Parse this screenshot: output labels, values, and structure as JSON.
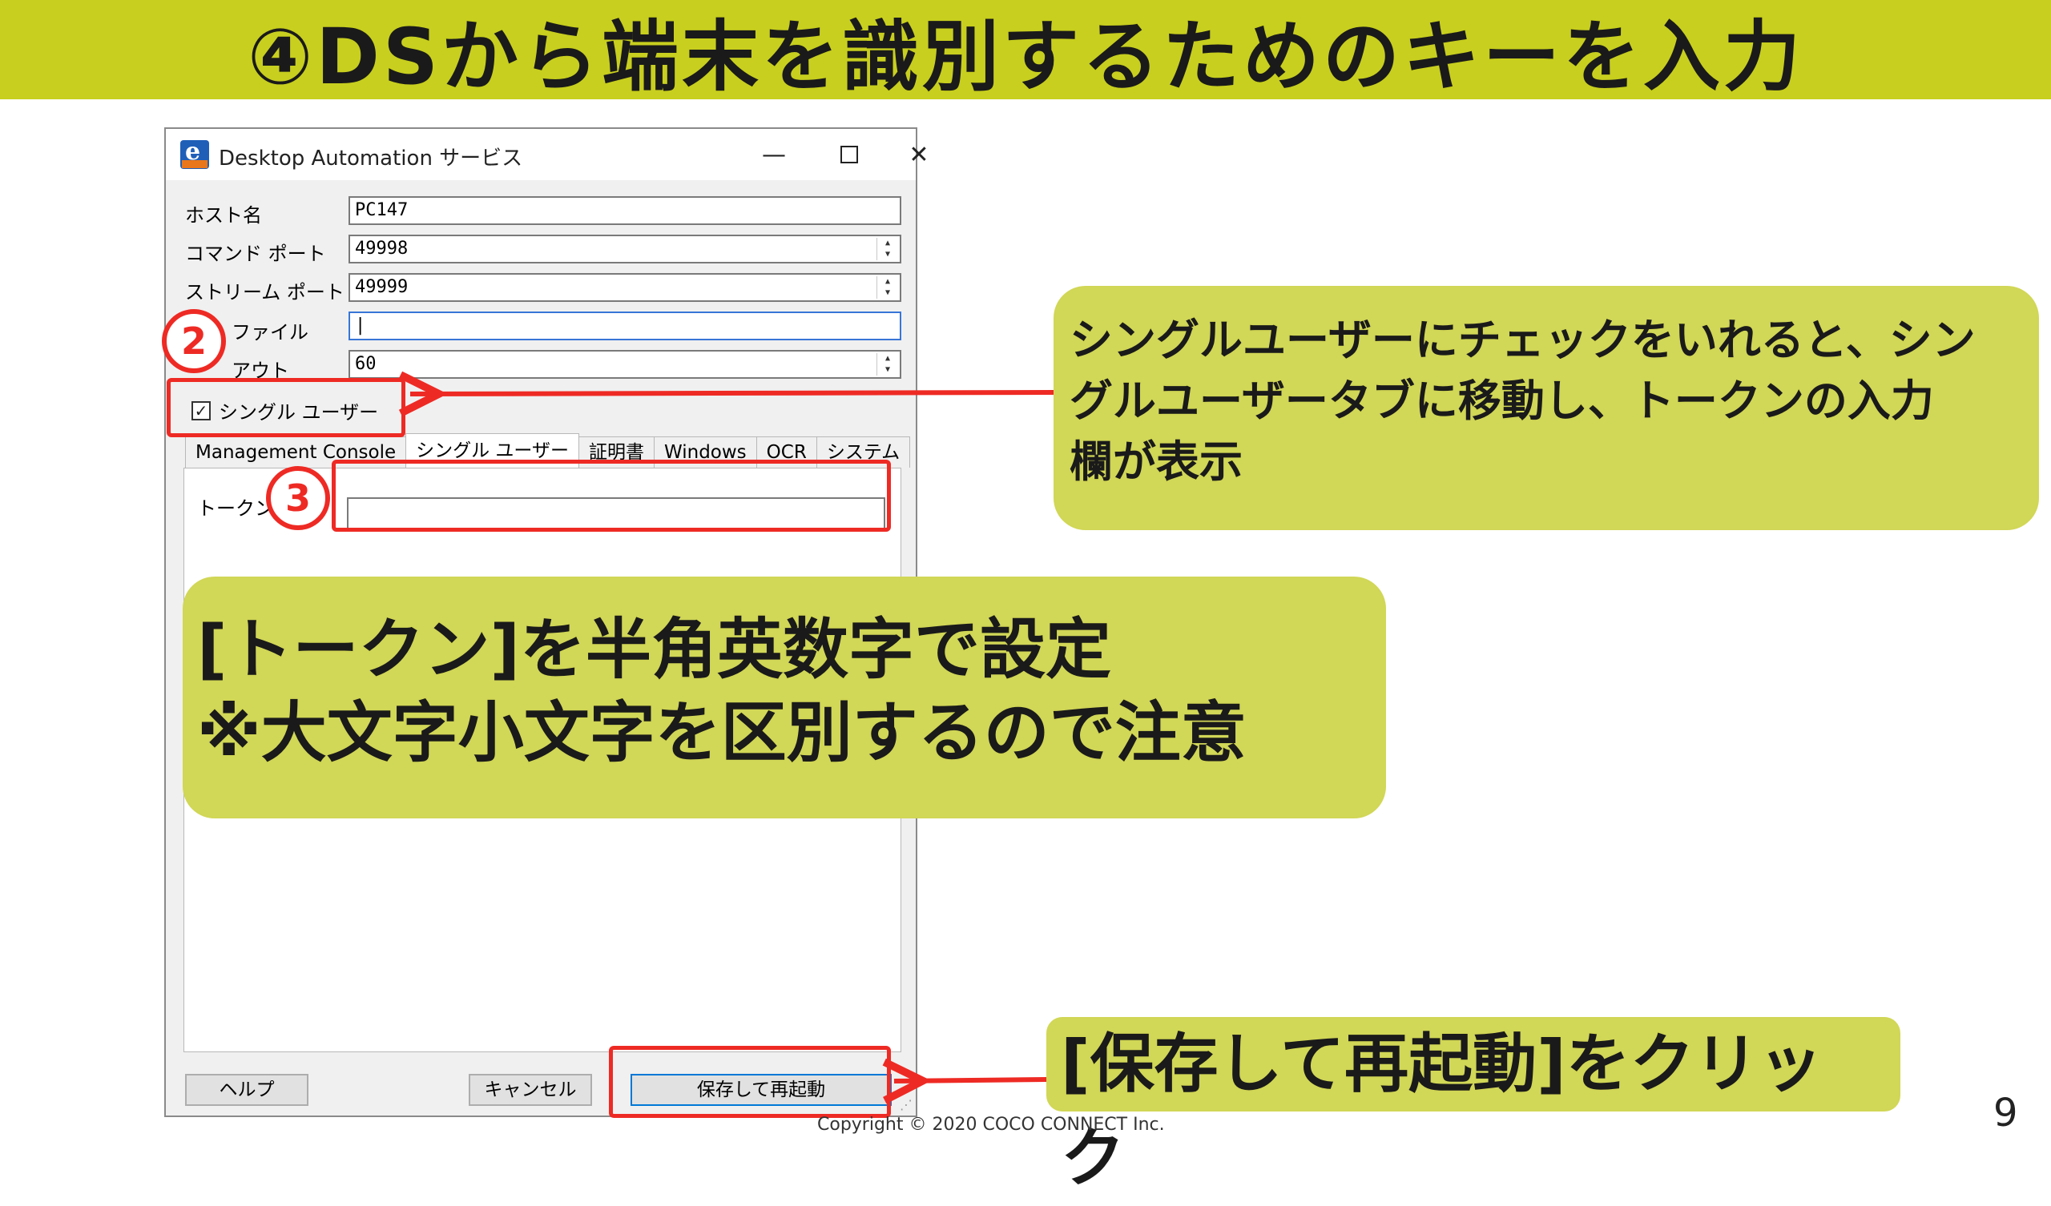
{
  "slide": {
    "title": "④DSから端末を識別するためのキーを入力",
    "page_number": "9",
    "copyright": "Copyright © 2020 COCO CONNECT Inc."
  },
  "window": {
    "title": "Desktop Automation サービス",
    "minimize": "—",
    "close": "✕"
  },
  "form": {
    "host_label": "ホスト名",
    "host_value": "PC147",
    "command_port_label": "コマンド ポート",
    "command_port_value": "49998",
    "stream_port_label": "ストリーム ポート",
    "stream_port_value": "49999",
    "log_file_label": "ファイル",
    "log_file_value": "|",
    "timeout_label": "アウト",
    "timeout_value": "60",
    "single_user_checkbox": "シングル ユーザー",
    "checkbox_mark": "✓"
  },
  "tabs": [
    "Management Console",
    "シングル ユーザー",
    "証明書",
    "Windows",
    "OCR",
    "システム"
  ],
  "token": {
    "label": "トークン",
    "value": ""
  },
  "buttons": {
    "help": "ヘルプ",
    "cancel": "キャンセル",
    "save_restart": "保存して再起動"
  },
  "markers": {
    "step2": "2",
    "step3": "3"
  },
  "callouts": {
    "single_user_note": [
      "シングルユーザーにチェックをいれると、シン",
      "グルユーザータブに移動し、トークンの入力",
      "欄が表示"
    ],
    "token_note": [
      "[トークン]を半角英数字で設定",
      "※大文字小文字を区別するので注意"
    ],
    "save_note": "[保存して再起動]をクリック"
  },
  "colors": {
    "header_bg": "#c8cf1e",
    "callout_bg": "#d1d756",
    "highlight_red": "#ee2a24"
  }
}
